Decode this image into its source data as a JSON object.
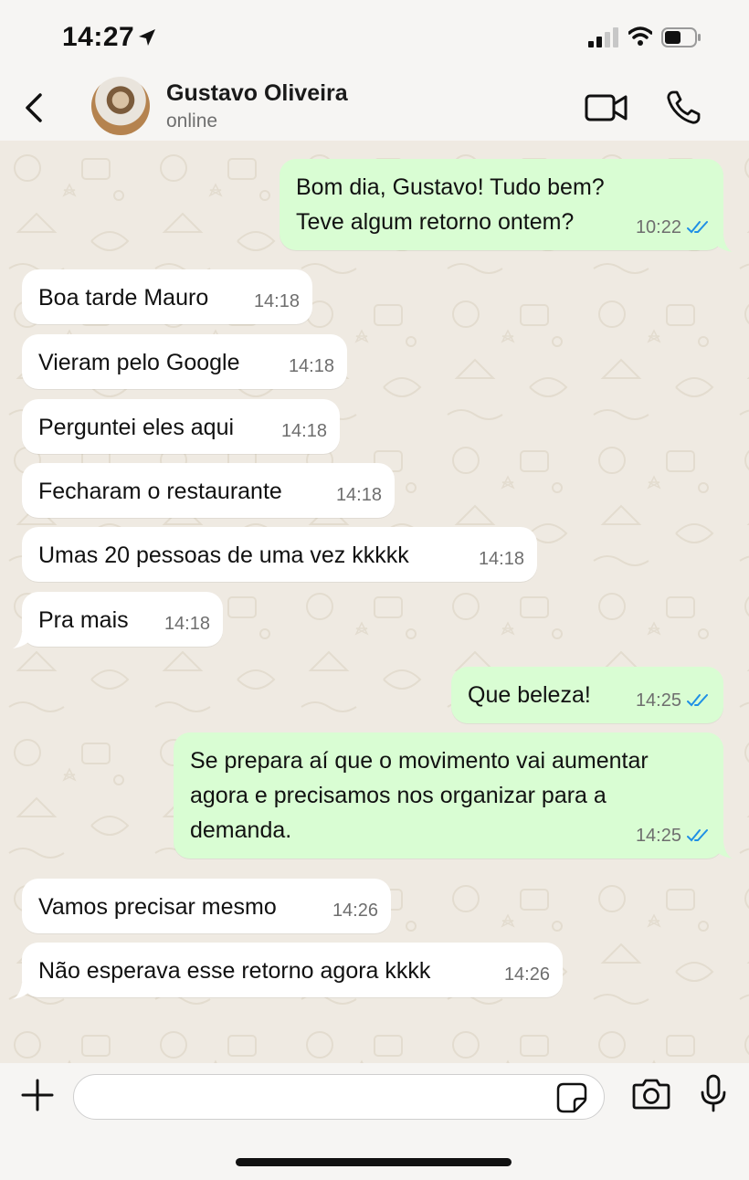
{
  "status_bar": {
    "time": "14:27"
  },
  "header": {
    "name": "Gustavo Oliveira",
    "status": "online"
  },
  "messages": [
    {
      "dir": "out",
      "text": "Bom dia, Gustavo! Tudo bem?\nTeve algum retorno ontem?",
      "time": "10:22",
      "read": true
    },
    {
      "dir": "in",
      "text": "Boa tarde Mauro",
      "time": "14:18"
    },
    {
      "dir": "in",
      "text": "Vieram pelo Google",
      "time": "14:18"
    },
    {
      "dir": "in",
      "text": "Perguntei eles aqui",
      "time": "14:18"
    },
    {
      "dir": "in",
      "text": "Fecharam o restaurante",
      "time": "14:18"
    },
    {
      "dir": "in",
      "text": "Umas 20 pessoas de uma vez kkkkk",
      "time": "14:18"
    },
    {
      "dir": "in",
      "text": "Pra mais",
      "time": "14:18"
    },
    {
      "dir": "out",
      "text": "Que beleza!",
      "time": "14:25",
      "read": true
    },
    {
      "dir": "out",
      "text": "Se prepara aí que o movimento vai aumentar\nagora e precisamos nos organizar para a\ndemanda.",
      "time": "14:25",
      "read": true
    },
    {
      "dir": "in",
      "text": "Vamos precisar mesmo",
      "time": "14:26"
    },
    {
      "dir": "in",
      "text": "Não esperava esse retorno agora kkkk",
      "time": "14:26"
    }
  ],
  "composer": {
    "placeholder": ""
  },
  "colors": {
    "outgoing": "#d9fdd3",
    "incoming": "#ffffff",
    "chat_bg": "#efeae2",
    "read_ticks": "#1f8fe5"
  }
}
